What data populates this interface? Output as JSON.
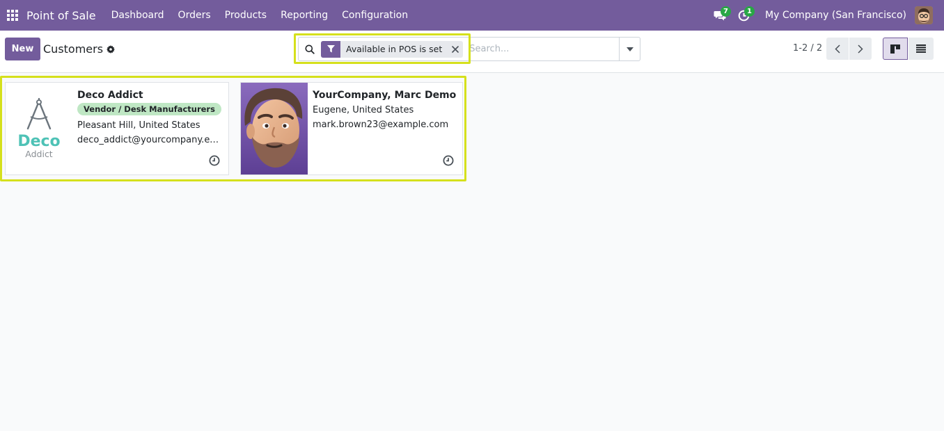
{
  "navbar": {
    "app_name": "Point of Sale",
    "menu": [
      "Dashboard",
      "Orders",
      "Products",
      "Reporting",
      "Configuration"
    ],
    "messages_count": "7",
    "activities_count": "1",
    "company": "My Company (San Francisco)"
  },
  "control_panel": {
    "new_label": "New",
    "title": "Customers",
    "facet_label": "Available in POS is set",
    "search_placeholder": "Search...",
    "pager": "1-2 / 2"
  },
  "customers": [
    {
      "name": "Deco Addict",
      "tag": "Vendor / Desk Manufacturers",
      "location": "Pleasant Hill, United States",
      "email": "deco_addict@yourcompany.example.com",
      "logo_word_1": "Deco",
      "logo_word_2": "Addict"
    },
    {
      "name": "YourCompany, Marc Demo",
      "location": "Eugene, United States",
      "email": "mark.brown23@example.com"
    }
  ],
  "colors": {
    "brand": "#735c9c",
    "highlight": "#d5e01c",
    "badge": "#28a745",
    "tag_bg": "#bfe7c4",
    "logo_teal": "#4ec2b6"
  },
  "icons": [
    "apps-grid-icon",
    "chat-icon",
    "activity-clock-icon",
    "gear-icon",
    "search-icon",
    "filter-icon",
    "close-icon",
    "caret-down-icon",
    "chevron-left-icon",
    "chevron-right-icon",
    "kanban-view-icon",
    "list-view-icon",
    "clock-icon"
  ]
}
